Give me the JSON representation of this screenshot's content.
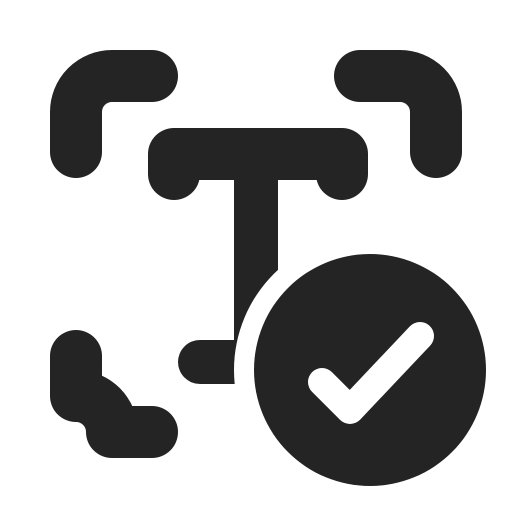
{
  "icon": {
    "name": "text-recognition-check-icon",
    "colors": {
      "foreground": "#242424",
      "background": "#ffffff",
      "check_mark": "#ffffff"
    }
  }
}
